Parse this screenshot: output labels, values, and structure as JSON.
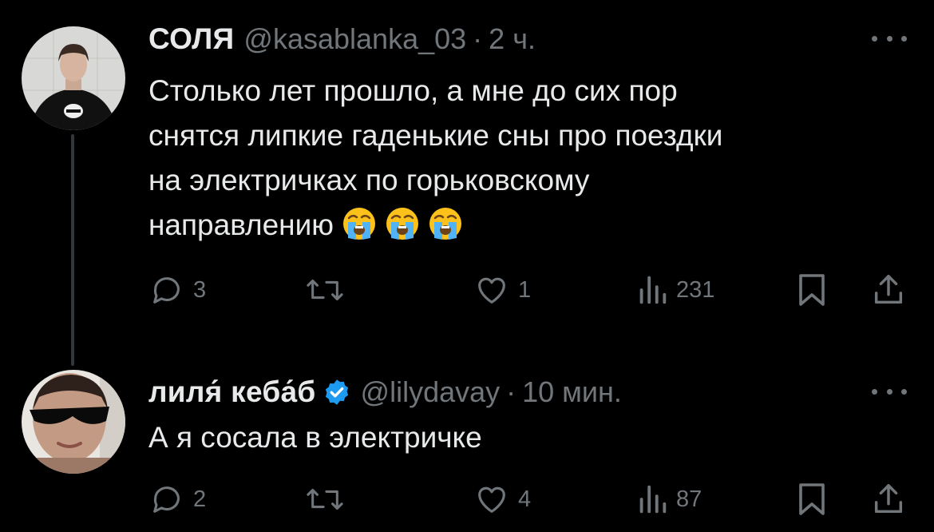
{
  "tweets": [
    {
      "author": "СОЛЯ",
      "handle": "@kasablanka_03",
      "separator": "·",
      "time": "2 ч.",
      "lines": [
        "Столько лет прошло, а мне до сих пор",
        "снятся липкие гаденькие сны про поездки",
        "на электричках по горьковскому",
        "направлению"
      ],
      "emojis": [
        "loudly-crying-face",
        "loudly-crying-face",
        "loudly-crying-face"
      ],
      "stats": {
        "replies": "3",
        "reposts": "",
        "likes": "1",
        "views": "231"
      }
    },
    {
      "author": "лиля́ кеба́б",
      "verified": true,
      "handle": "@lilydavay",
      "separator": "·",
      "time": "10 мин.",
      "lines": [
        "А я сосала в электричке"
      ],
      "stats": {
        "replies": "2",
        "reposts": "",
        "likes": "4",
        "views": "87"
      }
    }
  ],
  "colors": {
    "background": "#000000",
    "text": "#e7e9ea",
    "muted": "#71767b",
    "verified": "#1d9bf0",
    "thread_line": "#333639"
  },
  "icons": [
    "reply-icon",
    "repost-icon",
    "like-icon",
    "views-icon",
    "bookmark-icon",
    "share-icon",
    "more-icon",
    "verified-badge-icon"
  ]
}
